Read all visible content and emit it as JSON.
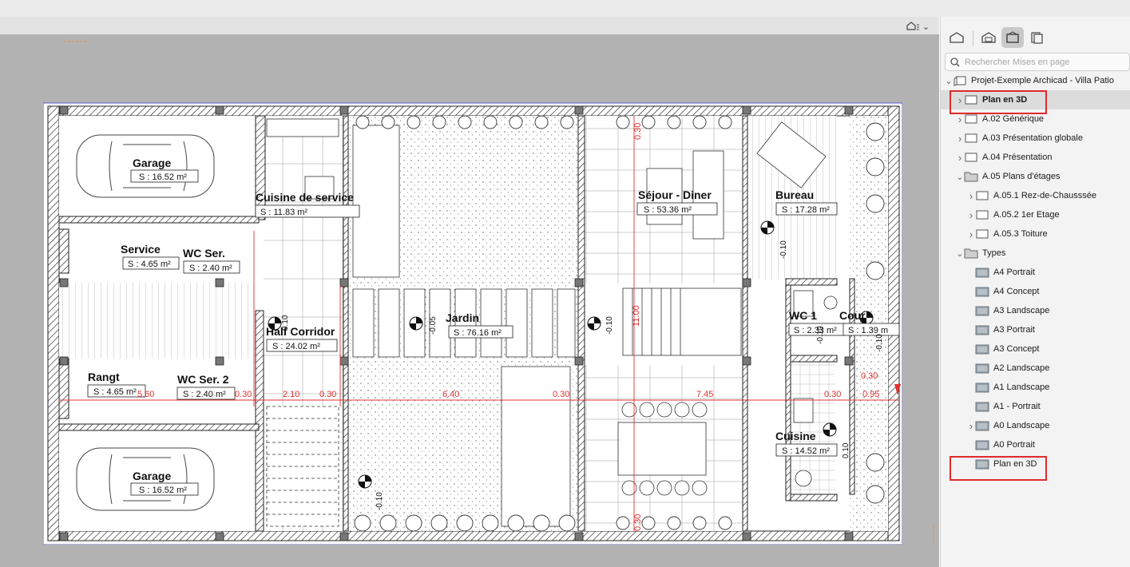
{
  "canvas": {
    "view_control_icon": "home-view-icon",
    "plan": {
      "rooms": [
        {
          "name": "Garage",
          "area": "S : 16.52 m²"
        },
        {
          "name": "Cuisine de service",
          "area": "S :       11.83 m²"
        },
        {
          "name": "Service",
          "area": "S : 4.65 m²"
        },
        {
          "name": "WC Ser.",
          "area": "S : 2.40 m²"
        },
        {
          "name": "Half Corridor",
          "area": "S : 24.02 m²"
        },
        {
          "name": "Rangt",
          "area": "S : 4.65 m²"
        },
        {
          "name": "WC Ser. 2",
          "area": "S : 2.40 m²"
        },
        {
          "name": "Garage",
          "area": "S : 16.52 m²"
        },
        {
          "name": "Jardin",
          "area": "S : 76.16 m²"
        },
        {
          "name": "Séjour - Diner",
          "area": "S :     53.36 m²"
        },
        {
          "name": "Bureau",
          "area": "S : 17.28 m²"
        },
        {
          "name": "WC 1",
          "area": "S : 2.33 m²"
        },
        {
          "name": "Cour",
          "area": "S : 1.39 m"
        },
        {
          "name": "Cuisine",
          "area": "S : 14.52 m²"
        }
      ],
      "dimensions": [
        "5.60",
        "0.30",
        "2.10",
        "0.30",
        "6.40",
        "0.30",
        "7.45",
        "0.30",
        "0.95",
        "0.30"
      ],
      "vertical_dims": [
        "0.30",
        "11.00",
        "0.30"
      ],
      "level_marks": [
        "-0.10",
        "-0.05",
        "-0.10",
        "-0.10",
        "0.10",
        "-0.10",
        "-0.10",
        "-0.10",
        "0.10"
      ]
    }
  },
  "panel": {
    "toolbar": [
      {
        "icon": "project-map-icon",
        "active": false
      },
      {
        "icon": "view-map-icon",
        "active": false
      },
      {
        "icon": "layout-book-icon",
        "active": true
      },
      {
        "icon": "publisher-sets-icon",
        "active": false
      }
    ],
    "search": {
      "placeholder": "Rechercher Mises en page"
    },
    "tree": [
      {
        "label": "Projet-Exemple Archicad - Villa Patio",
        "chevron": "down",
        "icon": "book-icon",
        "indent": 0
      },
      {
        "label": "Plan en 3D",
        "chevron": "right",
        "icon": "layout-icon",
        "indent": 1,
        "selected": true,
        "bold": true
      },
      {
        "label": "A.02 Générique",
        "chevron": "right",
        "icon": "layout-icon",
        "indent": 1
      },
      {
        "label": "A.03 Présentation globale",
        "chevron": "right",
        "icon": "layout-icon",
        "indent": 1
      },
      {
        "label": "A.04 Présentation",
        "chevron": "right",
        "icon": "layout-icon",
        "indent": 1
      },
      {
        "label": "A.05 Plans d'étages",
        "chevron": "down",
        "icon": "folder-icon",
        "indent": 1
      },
      {
        "label": "A.05.1 Rez-de-Chausssée",
        "chevron": "right",
        "icon": "layout-icon",
        "indent": 2
      },
      {
        "label": "A.05.2 1er Etage",
        "chevron": "right",
        "icon": "layout-icon",
        "indent": 2
      },
      {
        "label": "A.05.3 Toiture",
        "chevron": "right",
        "icon": "layout-icon",
        "indent": 2
      },
      {
        "label": "Types",
        "chevron": "down",
        "icon": "folder-icon",
        "indent": 1
      },
      {
        "label": "A4 Portrait",
        "chevron": "",
        "icon": "master-icon",
        "indent": 2
      },
      {
        "label": "A4 Concept",
        "chevron": "",
        "icon": "master-icon",
        "indent": 2
      },
      {
        "label": "A3 Landscape",
        "chevron": "",
        "icon": "master-icon",
        "indent": 2
      },
      {
        "label": "A3 Portrait",
        "chevron": "",
        "icon": "master-icon",
        "indent": 2
      },
      {
        "label": "A3 Concept",
        "chevron": "",
        "icon": "master-icon",
        "indent": 2
      },
      {
        "label": "A2 Landscape",
        "chevron": "",
        "icon": "master-icon",
        "indent": 2
      },
      {
        "label": "A1 Landscape",
        "chevron": "",
        "icon": "master-icon",
        "indent": 2
      },
      {
        "label": "A1 - Portrait",
        "chevron": "",
        "icon": "master-icon",
        "indent": 2
      },
      {
        "label": "A0 Landscape",
        "chevron": "right",
        "icon": "master-icon",
        "indent": 2
      },
      {
        "label": "A0 Portrait",
        "chevron": "",
        "icon": "master-icon",
        "indent": 2
      },
      {
        "label": "Plan en 3D",
        "chevron": "",
        "icon": "master-icon",
        "indent": 2
      }
    ]
  },
  "colors": {
    "highlight": "#e02a2a",
    "dimension": "#e03030",
    "selection": "#dcdcdc"
  }
}
